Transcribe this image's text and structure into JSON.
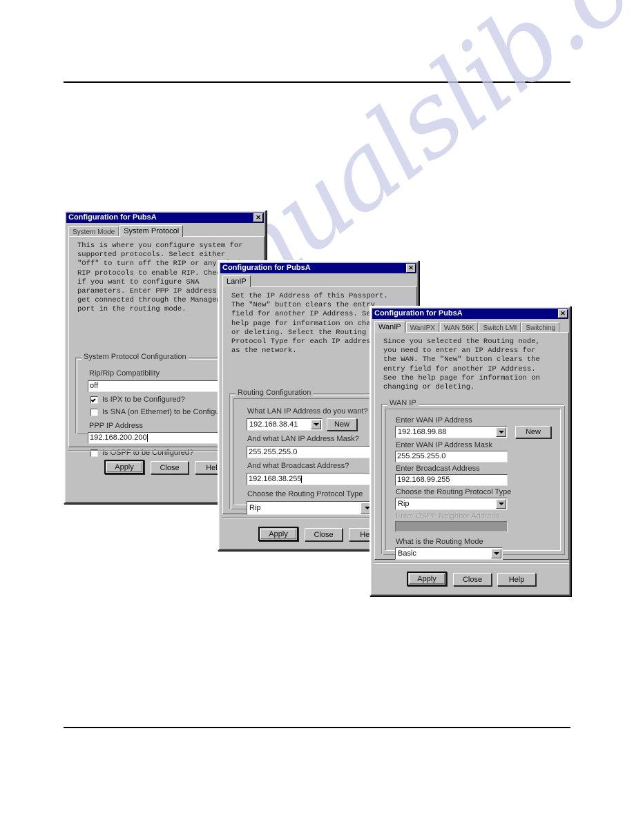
{
  "page": {
    "watermark": "manualslib.com"
  },
  "dialog1": {
    "title": "Configuration for PubsA",
    "close_icon": "✕",
    "tabs": [
      {
        "label": "System Mode",
        "active": false
      },
      {
        "label": "System Protocol",
        "active": true
      }
    ],
    "help_text": "This is where you configure system for\nsupported protocols. Select either\n\"Off\" to turn off the RIP or any of the\nRIP protocols to enable RIP. Check the box\nif you want to configure SNA\nparameters. Enter PPP IP address to\nget connected through the Management\nport in the routing mode.",
    "group_label": "System Protocol Configuration",
    "fields": {
      "rip_label": "Rip/Rip Compatibility",
      "rip_value": "off",
      "ipx_label": "Is IPX to be Configured?",
      "ipx_checked": true,
      "sna_label": "Is SNA (on Ethernet) to be Configured?",
      "sna_checked": false,
      "ppp_label": "PPP IP Address",
      "ppp_value": "192.168.200.200",
      "ospf_label": "Is OSPF to be Configured?",
      "ospf_checked": false
    },
    "buttons": {
      "apply": "Apply",
      "close": "Close",
      "help": "Help"
    }
  },
  "dialog2": {
    "title": "Configuration for PubsA",
    "close_icon": "✕",
    "tabs": [
      {
        "label": "LanIP",
        "active": true
      }
    ],
    "help_text": "Set the IP Address of this Passport.\nThe \"New\" button clears the entry\nfield for another IP Address. See the\nhelp page for information on changing\nor deleting. Select the Routing\nProtocol Type for each IP address\nas the network.",
    "group_label": "Routing Configuration",
    "fields": {
      "lan_ip_label": "What LAN IP Address do you want?",
      "lan_ip_value": "192.168.38.41",
      "new_button": "New",
      "mask_label": "And what LAN IP Address Mask?",
      "mask_value": "255.255.255.0",
      "broadcast_label": "And what Broadcast Address?",
      "broadcast_value": "192.168.38.255",
      "proto_label": "Choose the Routing Protocol Type",
      "proto_value": "Rip"
    },
    "buttons": {
      "apply": "Apply",
      "close": "Close",
      "help": "Help"
    }
  },
  "dialog3": {
    "title": "Configuration for PubsA",
    "close_icon": "✕",
    "tabs": [
      {
        "label": "WanIP",
        "active": true
      },
      {
        "label": "WanIPX",
        "active": false
      },
      {
        "label": "WAN 56K",
        "active": false
      },
      {
        "label": "Switch LMI",
        "active": false
      },
      {
        "label": "Switching",
        "active": false
      }
    ],
    "help_text": "Since you selected the Routing node,\nyou need to enter an IP Address for\nthe WAN. The \"New\" button clears the\nentry field for another IP Address.\nSee the help page for information on\nchanging or deleting.",
    "group_label": "WAN IP",
    "fields": {
      "wan_ip_label": "Enter WAN IP Address",
      "wan_ip_value": "192.168.99.88",
      "new_button": "New",
      "mask_label": "Enter WAN IP Address Mask",
      "mask_value": "255.255.255.0",
      "broadcast_label": "Enter Broadcast Address",
      "broadcast_value": "192.168.99.255",
      "proto_label": "Choose the Routing Protocol Type",
      "proto_value": "Rip",
      "ospf_label": "Enter OSPF Neighbor Address",
      "ospf_value": "",
      "mode_label": "What is the Routing Mode",
      "mode_value": "Basic"
    },
    "buttons": {
      "apply": "Apply",
      "close": "Close",
      "help": "Help"
    }
  }
}
